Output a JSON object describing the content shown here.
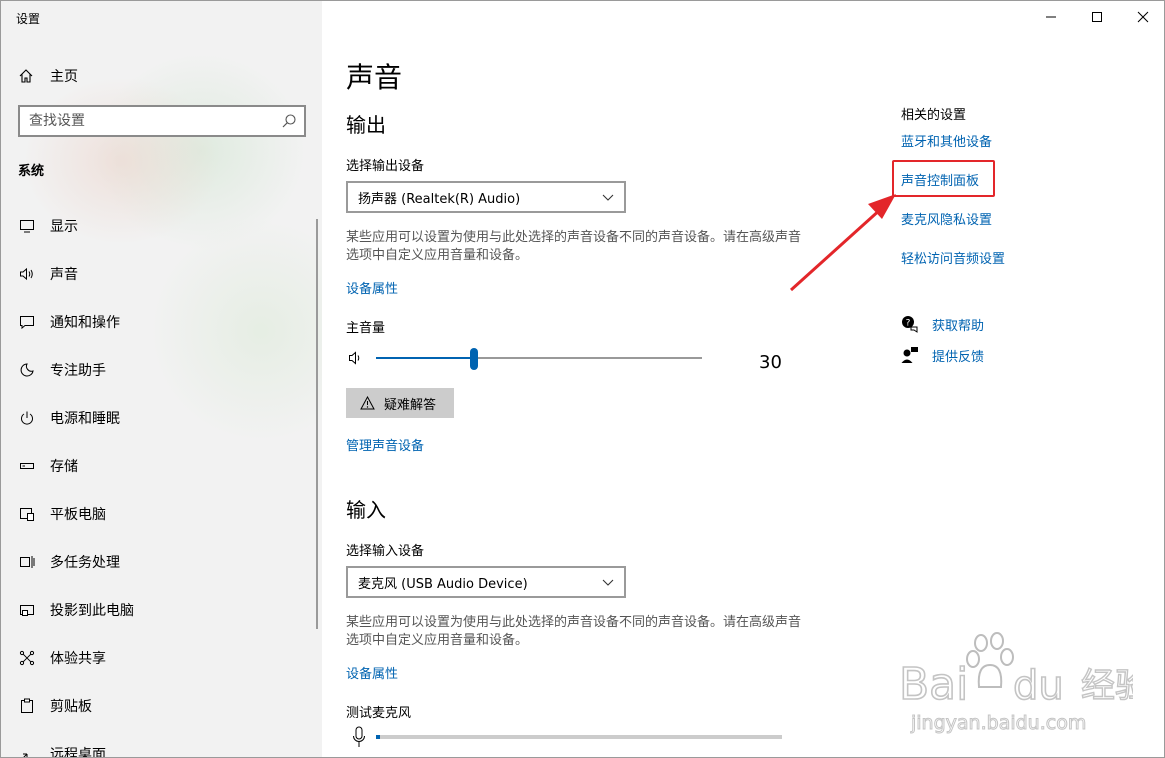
{
  "window": {
    "title": "设置"
  },
  "sidebar": {
    "home": {
      "label": "主页",
      "icon": "home-icon"
    },
    "search": {
      "placeholder": "查找设置",
      "icon": "search-icon"
    },
    "section": "系统",
    "items": [
      {
        "label": "显示",
        "icon": "monitor-icon"
      },
      {
        "label": "声音",
        "icon": "speaker-icon",
        "active": true
      },
      {
        "label": "通知和操作",
        "icon": "notification-icon"
      },
      {
        "label": "专注助手",
        "icon": "moon-icon"
      },
      {
        "label": "电源和睡眠",
        "icon": "power-icon"
      },
      {
        "label": "存储",
        "icon": "storage-icon"
      },
      {
        "label": "平板电脑",
        "icon": "tablet-icon"
      },
      {
        "label": "多任务处理",
        "icon": "multitask-icon"
      },
      {
        "label": "投影到此电脑",
        "icon": "project-icon"
      },
      {
        "label": "体验共享",
        "icon": "share-icon"
      },
      {
        "label": "剪贴板",
        "icon": "clipboard-icon"
      },
      {
        "label": "远程桌面",
        "icon": "remote-icon"
      }
    ]
  },
  "main": {
    "title": "声音",
    "output": {
      "heading": "输出",
      "device_label": "选择输出设备",
      "device_value": "扬声器 (Realtek(R) Audio)",
      "desc": "某些应用可以设置为使用与此处选择的声音设备不同的声音设备。请在高级声音选项中自定义应用音量和设备。",
      "device_props": "设备属性",
      "volume_label": "主音量",
      "volume_value": "30",
      "volume_level": 0.3,
      "troubleshoot": "疑难解答",
      "manage": "管理声音设备"
    },
    "input": {
      "heading": "输入",
      "device_label": "选择输入设备",
      "device_value": "麦克风 (USB Audio Device)",
      "desc": "某些应用可以设置为使用与此处选择的声音设备不同的声音设备。请在高级声音选项中自定义应用音量和设备。",
      "device_props": "设备属性",
      "test_label": "测试麦克风",
      "mic_level": 0.01
    },
    "related": {
      "title": "相关的设置",
      "links": [
        "蓝牙和其他设备",
        "声音控制面板",
        "麦克风隐私设置",
        "轻松访问音频设置"
      ],
      "help": "获取帮助",
      "feedback": "提供反馈"
    }
  },
  "colors": {
    "accent": "#0063b1",
    "highlight": "#e3262a"
  },
  "watermark": {
    "text": "Baidu经验",
    "url_text": "jingyan.baidu.com"
  }
}
